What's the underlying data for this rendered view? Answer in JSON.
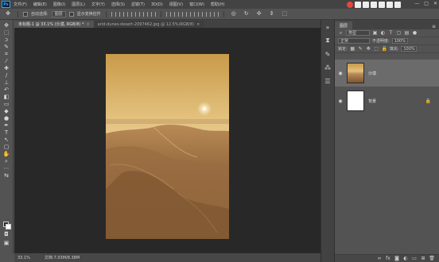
{
  "app": {
    "logo_text": "Ps"
  },
  "menu": [
    "文件(F)",
    "编辑(E)",
    "图像(I)",
    "图层(L)",
    "文字(Y)",
    "选择(S)",
    "滤镜(T)",
    "3D(D)",
    "视图(V)",
    "窗口(W)",
    "帮助(H)"
  ],
  "window_controls": {
    "minimize": "—",
    "maximize": "□",
    "close": "✕"
  },
  "options": {
    "auto_select_label": "自动选择:",
    "auto_select_target": "图层",
    "show_transform_label": "显示变换控件"
  },
  "tabs": [
    {
      "label": "未标题-1 @ 33.1% (沙漠, RGB/8) *",
      "close": "×",
      "active": true
    },
    {
      "label": "arid-dunes-desert-2097462.jpg @ 12.5%(RGB/8)",
      "close": "×",
      "active": false
    }
  ],
  "status": {
    "zoom": "33.1%",
    "doc_info": "文档:7.03M/8.38M"
  },
  "layers_panel": {
    "tab_label": "图层",
    "filter_label": "类型",
    "blend_mode": "正常",
    "opacity_label": "不透明度:",
    "opacity_value": "100%",
    "lock_label": "锁定:",
    "fill_label": "填充:",
    "fill_value": "100%",
    "layers": [
      {
        "name": "沙漠",
        "visible": true,
        "selected": true
      },
      {
        "name": "背景",
        "visible": true,
        "selected": false,
        "locked": true
      }
    ]
  },
  "colors": {
    "accent": "#31a8ff",
    "canvas_bg": "#282828",
    "panel_bg": "#535353",
    "foreground_swatch": "#3a2a1d",
    "background_swatch": "#ffffff"
  }
}
